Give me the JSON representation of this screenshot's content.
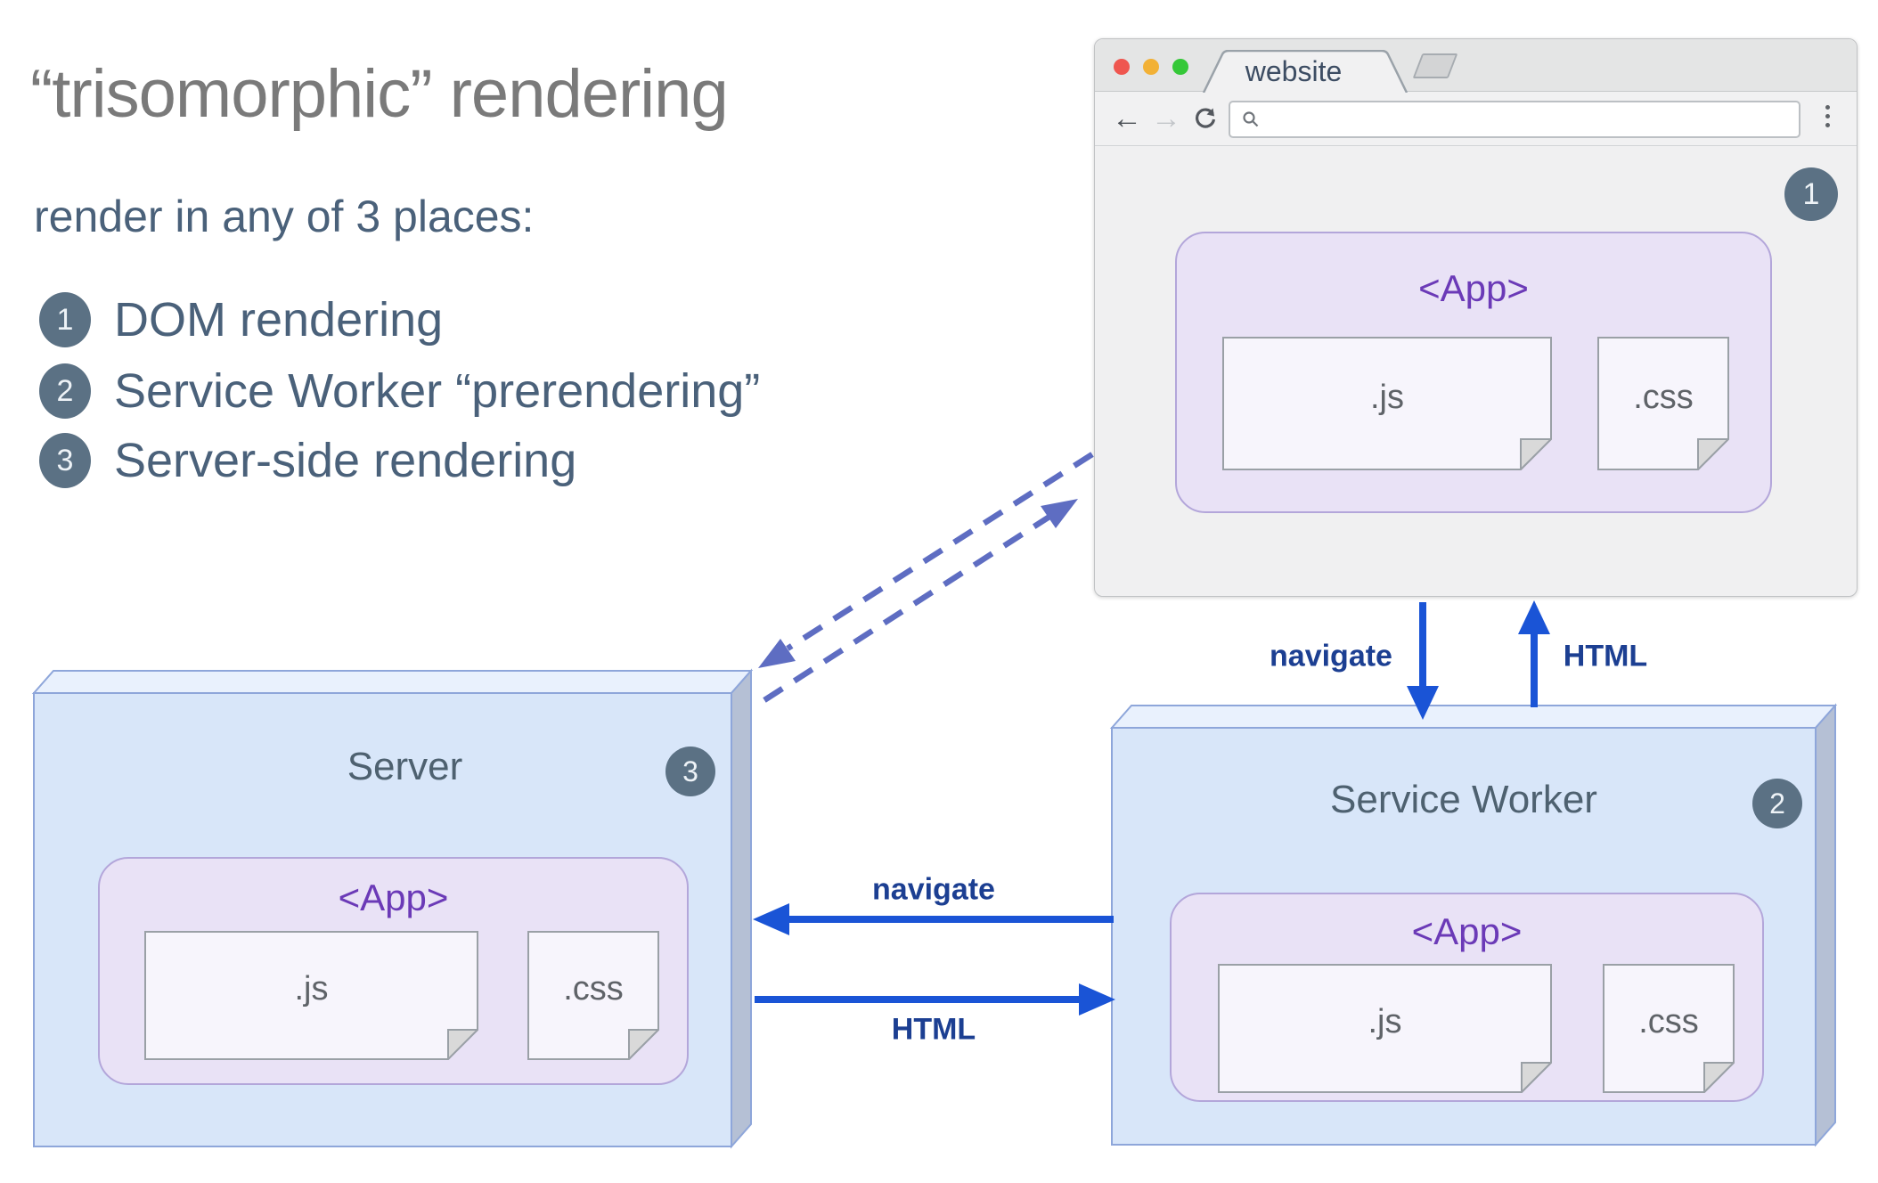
{
  "colors": {
    "arrow_blue": "#1a54d6",
    "arrow_label_navy": "#1c3f92",
    "dashed_periwinkle": "#5e6dc2",
    "badge_slate": "#5b7184",
    "app_purple": "#6b3ab7",
    "app_fill_lavender": "#e9e2f6",
    "box_front_blue": "#d8e6f9",
    "box_top_blue": "#e9f1fd",
    "box_side_gray": "#b5c0d5",
    "title_gray": "#7a7a7a",
    "text_slate": "#4a617a"
  },
  "heading": {
    "title": "“trisomorphic” rendering",
    "subtitle": "render in any of 3 places:"
  },
  "legend": {
    "items": [
      {
        "num": "1",
        "label": "DOM rendering"
      },
      {
        "num": "2",
        "label": "Service Worker “prerendering”"
      },
      {
        "num": "3",
        "label": "Server-side rendering"
      }
    ]
  },
  "browser": {
    "badge": "1",
    "tab_title": "website",
    "nav": {
      "back_icon": "←",
      "forward_icon": "→",
      "url_value": ""
    },
    "app": {
      "label": "<App>",
      "files": [
        ".js",
        ".css"
      ]
    }
  },
  "server": {
    "badge": "3",
    "title": "Server",
    "app": {
      "label": "<App>",
      "files": [
        ".js",
        ".css"
      ]
    }
  },
  "service_worker": {
    "badge": "2",
    "title": "Service Worker",
    "app": {
      "label": "<App>",
      "files": [
        ".js",
        ".css"
      ]
    }
  },
  "arrows": {
    "browser_sw": {
      "down_label": "navigate",
      "up_label": "HTML"
    },
    "server_sw": {
      "left_label": "navigate",
      "right_label": "HTML"
    }
  }
}
